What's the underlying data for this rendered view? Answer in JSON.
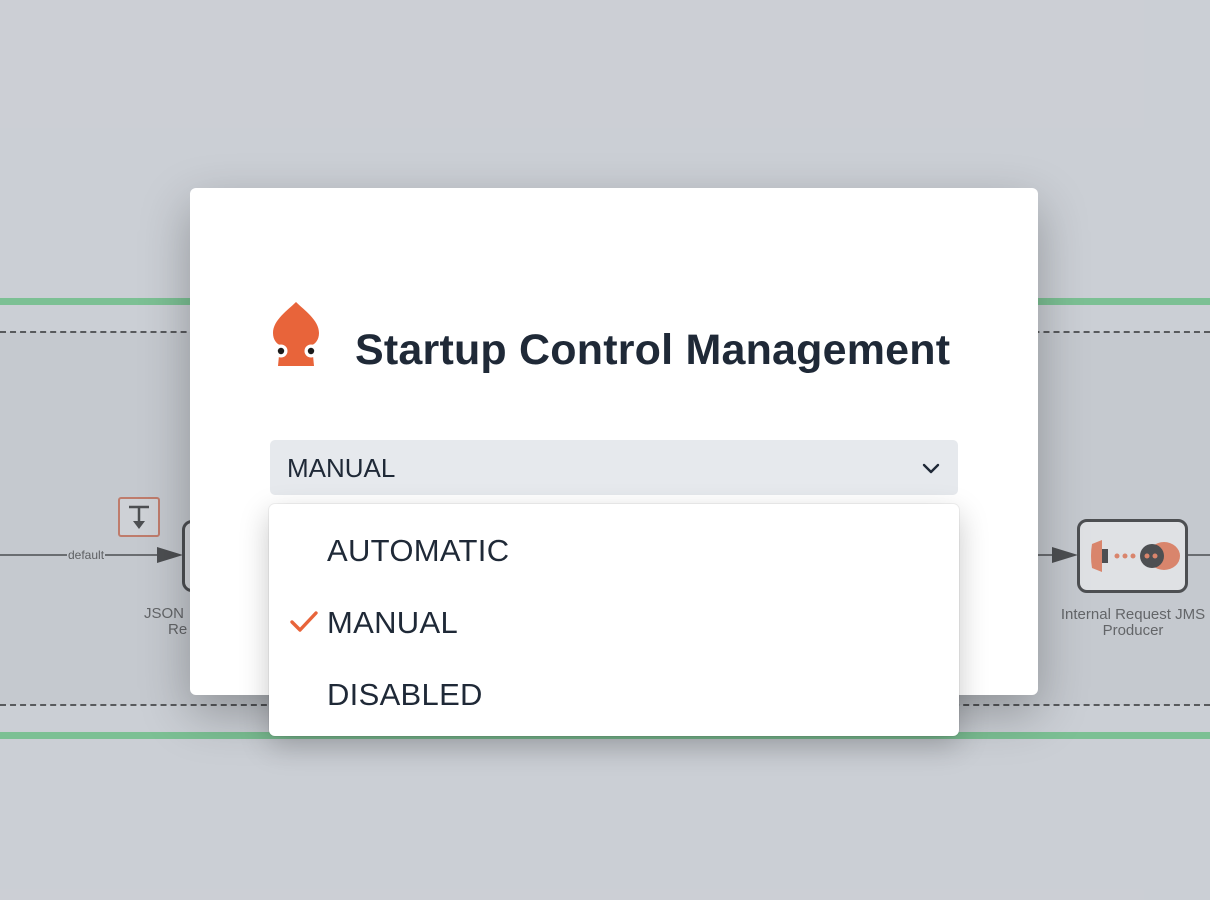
{
  "dialog": {
    "title": "Startup Control Management",
    "select": {
      "value": "MANUAL",
      "options": [
        {
          "label": "AUTOMATIC",
          "selected": false
        },
        {
          "label": "MANUAL",
          "selected": true
        },
        {
          "label": "DISABLED",
          "selected": false
        }
      ]
    }
  },
  "flow": {
    "edge_label": "default",
    "left_node_label_line1": "JSON",
    "left_node_label_line2": "Re",
    "right_node_label_line1": "Internal Request JMS",
    "right_node_label_line2": "Producer"
  },
  "colors": {
    "accent": "#e8643a",
    "lane_border": "#59bf77",
    "text": "#1f2937"
  },
  "icons": {
    "logo": "squid-logo-icon",
    "select_chevron": "chevron-down-icon",
    "selected_marker": "checkmark-icon",
    "pause_node": "pause-step-icon",
    "jms_producer": "jms-producer-icon"
  }
}
